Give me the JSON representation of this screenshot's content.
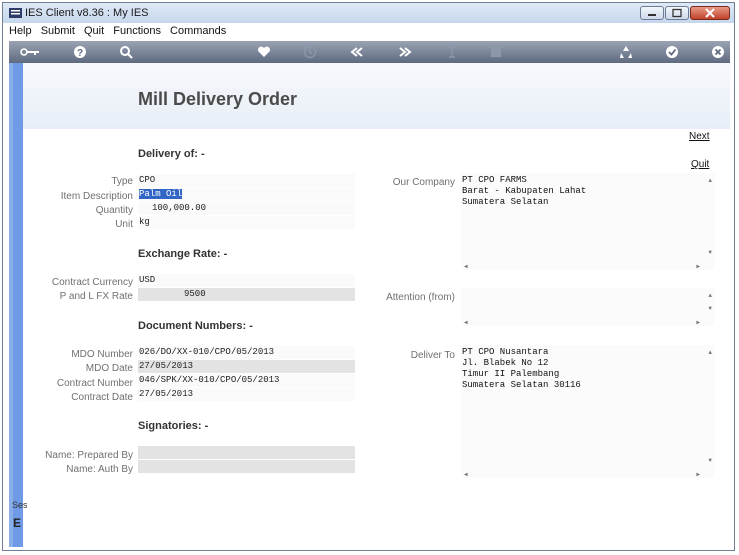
{
  "window": {
    "title": "IES Client v8.36 : My IES"
  },
  "menu": [
    "Help",
    "Submit",
    "Quit",
    "Functions",
    "Commands"
  ],
  "toolbar": {
    "icons": [
      "key-icon",
      "help-icon",
      "search-icon",
      "heart-icon",
      "clock-icon",
      "rewind-icon",
      "fast-forward-icon",
      "text-cursor-icon",
      "stop-icon",
      "recycle-icon",
      "check-icon",
      "close-icon"
    ]
  },
  "page": {
    "title": "Mill Delivery Order",
    "next": "Next",
    "quit": "Quit"
  },
  "sections": {
    "delivery": "Delivery of: -",
    "exchange": "Exchange Rate: -",
    "documents": "Document Numbers: -",
    "signatories": "Signatories: -"
  },
  "delivery": {
    "type_label": "Type",
    "type_value": "CPO",
    "item_label": "Item Description",
    "item_value": "Palm Oil",
    "qty_label": "Quantity",
    "qty_value": "100,000.00",
    "unit_label": "Unit",
    "unit_value": "kg"
  },
  "exchange": {
    "currency_label": "Contract Currency",
    "currency_value": "USD",
    "fx_label": "P and L  FX Rate",
    "fx_value": "9500"
  },
  "documents": {
    "mdo_number_label": "MDO Number",
    "mdo_number_value": "026/DO/XX-010/CPO/05/2013",
    "mdo_date_label": "MDO Date",
    "mdo_date_value": "27/05/2013",
    "contract_number_label": "Contract Number",
    "contract_number_value": "046/SPK/XX-010/CPO/05/2013",
    "contract_date_label": "Contract Date",
    "contract_date_value": "27/05/2013"
  },
  "signatories": {
    "prepared_label": "Name: Prepared By",
    "prepared_value": "",
    "auth_label": "Name: Auth By",
    "auth_value": ""
  },
  "right": {
    "company_label": "Our Company",
    "company_lines": [
      "PT CPO FARMS",
      "Barat - Kabupaten Lahat",
      "Sumatera Selatan"
    ],
    "attention_label": "Attention (from)",
    "attention_value": "",
    "deliver_label": "Deliver To",
    "deliver_lines": [
      "PT CPO Nusantara",
      "Jl. Blabek No 12",
      "Timur II Palembang",
      "Sumatera Selatan 30116"
    ]
  },
  "session": {
    "label": "Ses",
    "glyph": "E"
  }
}
